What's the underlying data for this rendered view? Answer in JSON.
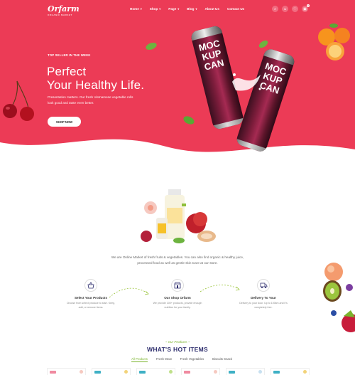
{
  "brand": {
    "name": "Orfarm",
    "tagline": "ORGANIC MARKET"
  },
  "nav": {
    "items": [
      {
        "label": "Home",
        "has_dropdown": true
      },
      {
        "label": "Shop",
        "has_dropdown": true
      },
      {
        "label": "Page",
        "has_dropdown": true
      },
      {
        "label": "Blog",
        "has_dropdown": true
      },
      {
        "label": "About Us",
        "has_dropdown": false
      },
      {
        "label": "Contact Us",
        "has_dropdown": false
      }
    ],
    "icons": [
      "search-icon",
      "user-icon",
      "heart-icon",
      "cart-icon"
    ],
    "cart_count": "0"
  },
  "hero": {
    "eyebrow": "TOP SELLER IN THE WEEK",
    "headline_line1": "Perfect",
    "headline_line2": "Your Healthy Life.",
    "description": "Presentation matters. Our fresh Vietnamese vegetable rolls look good and taste even better.",
    "cta": "SHOP NOW",
    "can_label_1": "MOC KUP CAN",
    "can_label_2": "MOC KUP CAN",
    "bg_color": "#ec3b56"
  },
  "intro": {
    "text": "We are Online Market of fresh fruits & vegetables. You can also find organic & healthy juice, processed food as well as gentle skin tcare at our store."
  },
  "steps": [
    {
      "icon": "basket-icon",
      "title": "Select Your Products",
      "desc": "Choose from select produce to start. Keep, add, or remove items."
    },
    {
      "icon": "store-icon",
      "title": "Our Shop Orfarm",
      "desc": "We provide 100+ products, provide enough nutrition for your family."
    },
    {
      "icon": "truck-icon",
      "title": "Delivery To Your",
      "desc": "Delivery to your door. Up to 100km and it's completely free."
    }
  ],
  "products": {
    "subtitle": "~ Our Products ~",
    "title": "WHAT'S HOT ITEMS",
    "tabs": [
      "All Products",
      "Fresh Meat",
      "Fresh Vegetables",
      "Biscuits Snack"
    ],
    "active_tab": "All Products"
  },
  "colors": {
    "accent": "#ec3b56",
    "green": "#7bb42d",
    "navy": "#2d2d6d"
  }
}
